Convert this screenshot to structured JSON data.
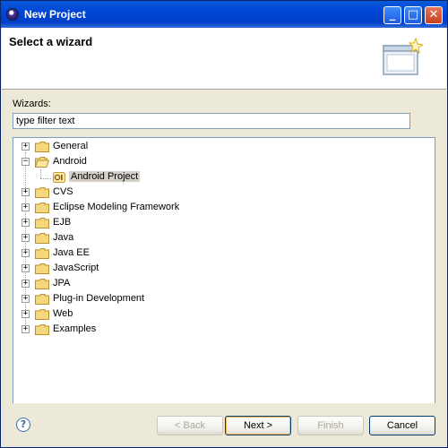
{
  "window": {
    "title": "New Project",
    "controls": {
      "minimize": "_",
      "maximize": "□",
      "close": "✕"
    }
  },
  "header": {
    "title": "Select a wizard"
  },
  "wizards": {
    "label": "Wizards:",
    "filter_value": "type filter text"
  },
  "tree": {
    "items": [
      {
        "label": "General",
        "expander": "+"
      },
      {
        "label": "Android",
        "expander": "−"
      },
      {
        "label": "Android Project",
        "child": true,
        "selected": true
      },
      {
        "label": "CVS",
        "expander": "+"
      },
      {
        "label": "Eclipse Modeling Framework",
        "expander": "+"
      },
      {
        "label": "EJB",
        "expander": "+"
      },
      {
        "label": "Java",
        "expander": "+"
      },
      {
        "label": "Java EE",
        "expander": "+"
      },
      {
        "label": "JavaScript",
        "expander": "+"
      },
      {
        "label": "JPA",
        "expander": "+"
      },
      {
        "label": "Plug-in Development",
        "expander": "+"
      },
      {
        "label": "Web",
        "expander": "+"
      },
      {
        "label": "Examples",
        "expander": "+"
      }
    ]
  },
  "footer": {
    "help": "?",
    "back_label": "< Back",
    "next_label": "Next >",
    "finish_label": "Finish",
    "cancel_label": "Cancel"
  },
  "colors": {
    "titlebar": "#0a5ad8",
    "dialog_bg": "#ece9d8",
    "selection_bg": "#d4d0c8",
    "input_border": "#7f9db9"
  }
}
